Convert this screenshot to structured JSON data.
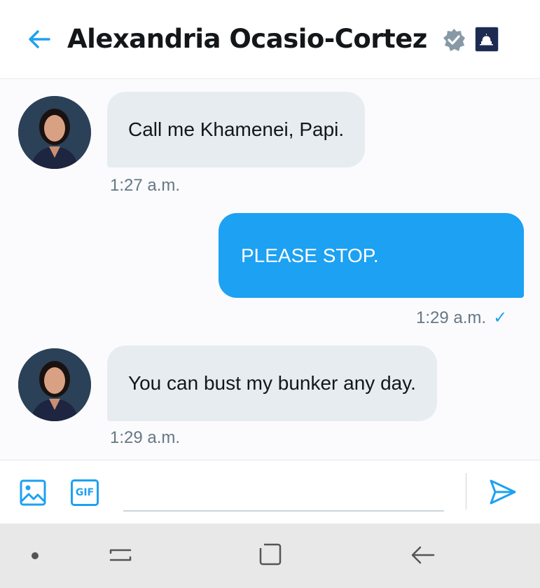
{
  "header": {
    "title": "Alexandria Ocasio-Cortez",
    "back_icon": "arrow-left-icon",
    "verified_icon": "verified-badge-icon",
    "badge_icon": "capitol-dome-icon"
  },
  "messages": [
    {
      "direction": "incoming",
      "text": "Call me Khamenei, Papi.",
      "time": "1:27 a.m."
    },
    {
      "direction": "outgoing",
      "text": "PLEASE STOP.",
      "time": "1:29 a.m.",
      "status": "✓"
    },
    {
      "direction": "incoming",
      "text": "You can bust my bunker any day.",
      "time": "1:29 a.m."
    }
  ],
  "composer": {
    "media_icon": "image-icon",
    "gif_label": "GIF",
    "input_value": "",
    "input_placeholder": "",
    "send_icon": "send-icon"
  },
  "navbar": {
    "icons": [
      "dot-icon",
      "recent-apps-icon",
      "home-icon",
      "back-icon"
    ]
  },
  "colors": {
    "accent": "#1da1f2",
    "incoming_bubble": "#e6ecf0",
    "text": "#14171a",
    "muted": "#657786"
  }
}
